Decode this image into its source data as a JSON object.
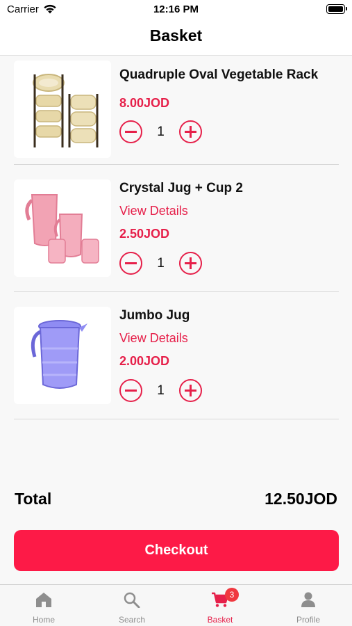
{
  "status_bar": {
    "carrier": "Carrier",
    "time": "12:16 PM"
  },
  "nav": {
    "title": "Basket"
  },
  "items": [
    {
      "name": "Quadruple Oval Vegetable Rack",
      "view_details": "",
      "price": "8.00JOD",
      "quantity": "1",
      "thumbnail": "vegetable-rack"
    },
    {
      "name": "Crystal Jug + Cup 2",
      "view_details": "View Details",
      "price": "2.50JOD",
      "quantity": "1",
      "thumbnail": "pink-jug-cups"
    },
    {
      "name": "Jumbo Jug",
      "view_details": "View Details",
      "price": "2.00JOD",
      "quantity": "1",
      "thumbnail": "purple-jug"
    }
  ],
  "total": {
    "label": "Total",
    "value": "12.50JOD"
  },
  "checkout": {
    "label": "Checkout"
  },
  "tabs": [
    {
      "label": "Home",
      "icon": "home-icon",
      "active": false
    },
    {
      "label": "Search",
      "icon": "search-icon",
      "active": false
    },
    {
      "label": "Basket",
      "icon": "cart-icon",
      "active": true,
      "badge": "3"
    },
    {
      "label": "Profile",
      "icon": "person-icon",
      "active": false
    }
  ],
  "colors": {
    "accent": "#e6204a",
    "checkout": "#fd1a47",
    "badge": "#f0383f",
    "inactive_tab": "#8e8e8e"
  }
}
